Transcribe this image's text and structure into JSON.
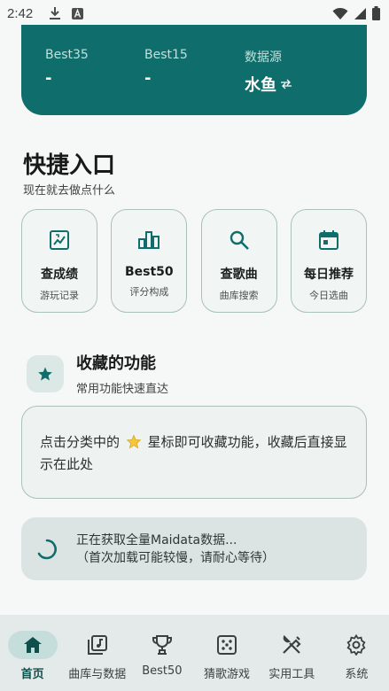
{
  "status_bar": {
    "time": "2:42",
    "icons": [
      "download-icon",
      "font-badge-icon",
      "wifi-icon",
      "signal-icon",
      "battery-icon"
    ]
  },
  "hero": {
    "stats": [
      {
        "label": "Best35",
        "value": "-"
      },
      {
        "label": "Best15",
        "value": "-"
      },
      {
        "label": "数据源",
        "value": "水鱼"
      }
    ],
    "switch_icon": "swap-icon",
    "colors": {
      "background": "#0f6e6b"
    }
  },
  "quick_access": {
    "title": "快捷入口",
    "subtitle": "现在就去做点什么",
    "cards": [
      {
        "title": "查成绩",
        "subtitle": "游玩记录",
        "icon": "score-icon"
      },
      {
        "title": "Best50",
        "subtitle": "评分构成",
        "icon": "bar-chart-icon"
      },
      {
        "title": "查歌曲",
        "subtitle": "曲库搜索",
        "icon": "search-icon"
      },
      {
        "title": "每日推荐",
        "subtitle": "今日选曲",
        "icon": "calendar-icon"
      }
    ]
  },
  "favorites": {
    "title": "收藏的功能",
    "subtitle": "常用功能快速直达",
    "hint_prefix": "点击分类中的",
    "hint_suffix": "星标即可收藏功能，收藏后直接显示在此处"
  },
  "loading": {
    "line1": "正在获取全量Maidata数据...",
    "line2": "（首次加载可能较慢，请耐心等待）"
  },
  "bottom_nav": {
    "items": [
      {
        "label": "首页",
        "icon": "home-icon",
        "active": true
      },
      {
        "label": "曲库与数据",
        "icon": "music-library-icon",
        "active": false
      },
      {
        "label": "Best50",
        "icon": "trophy-icon",
        "active": false
      },
      {
        "label": "猜歌游戏",
        "icon": "dice-icon",
        "active": false
      },
      {
        "label": "实用工具",
        "icon": "tools-icon",
        "active": false
      },
      {
        "label": "系统",
        "icon": "gear-icon",
        "active": false
      }
    ]
  },
  "colors": {
    "accent": "#0f6e6b",
    "background": "#f6f8f7",
    "nav_background": "#e4eae9"
  }
}
